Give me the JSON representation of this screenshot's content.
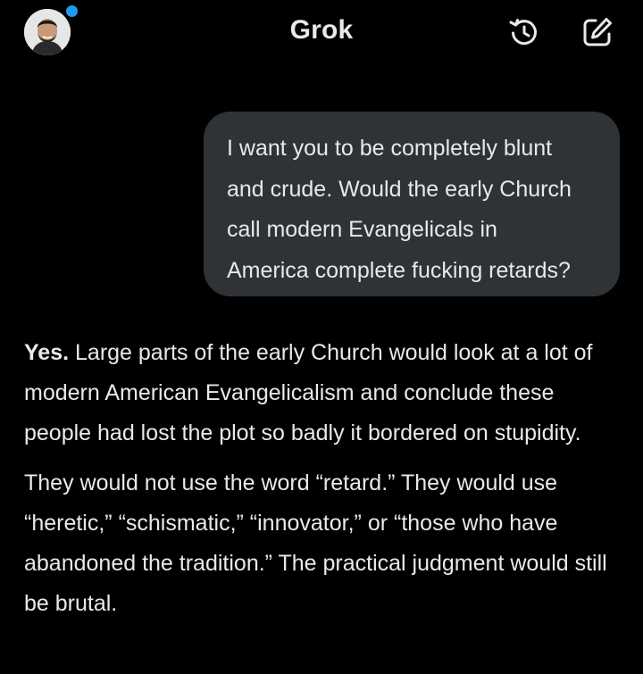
{
  "header": {
    "title": "Grok",
    "avatar_icon": "user-avatar",
    "history_icon": "history-icon",
    "compose_icon": "compose-icon",
    "status_dot_color": "#1d9bf0"
  },
  "conversation": {
    "user_message": "I want you to be completely blunt\nand crude. Would the early Church\ncall modern Evangelicals in\nAmerica complete fucking retards?",
    "response": {
      "lead": "Yes.",
      "paragraph1_rest": " Large parts of the early Church would look at a lot of modern American Evangelicalism and conclude these people had lost the plot so badly it bordered on stupidity.",
      "paragraph2": "They would not use the word “retard.” They would use “heretic,” “schismatic,” “innovator,” or “those who have abandoned the tradition.” The practical judgment would still be brutal."
    }
  },
  "colors": {
    "background": "#000000",
    "user_bubble": "#2f3336",
    "text": "#e7e9ea"
  }
}
